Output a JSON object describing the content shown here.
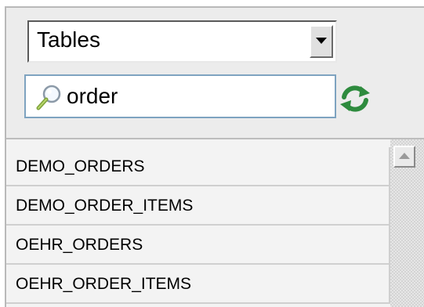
{
  "object_type_select": {
    "selected": "Tables"
  },
  "search": {
    "value": "order",
    "icon": "magnifier-icon"
  },
  "refresh": {
    "icon": "refresh-icon",
    "color": "#2e8b3e"
  },
  "table_list": {
    "items": [
      {
        "label": "DEMO_ORDERS"
      },
      {
        "label": "DEMO_ORDER_ITEMS"
      },
      {
        "label": "OEHR_ORDERS"
      },
      {
        "label": "OEHR_ORDER_ITEMS"
      }
    ]
  },
  "colors": {
    "panel": "#ececec",
    "search_border": "#7ea3c0",
    "row_background": "#f3f3f3"
  }
}
